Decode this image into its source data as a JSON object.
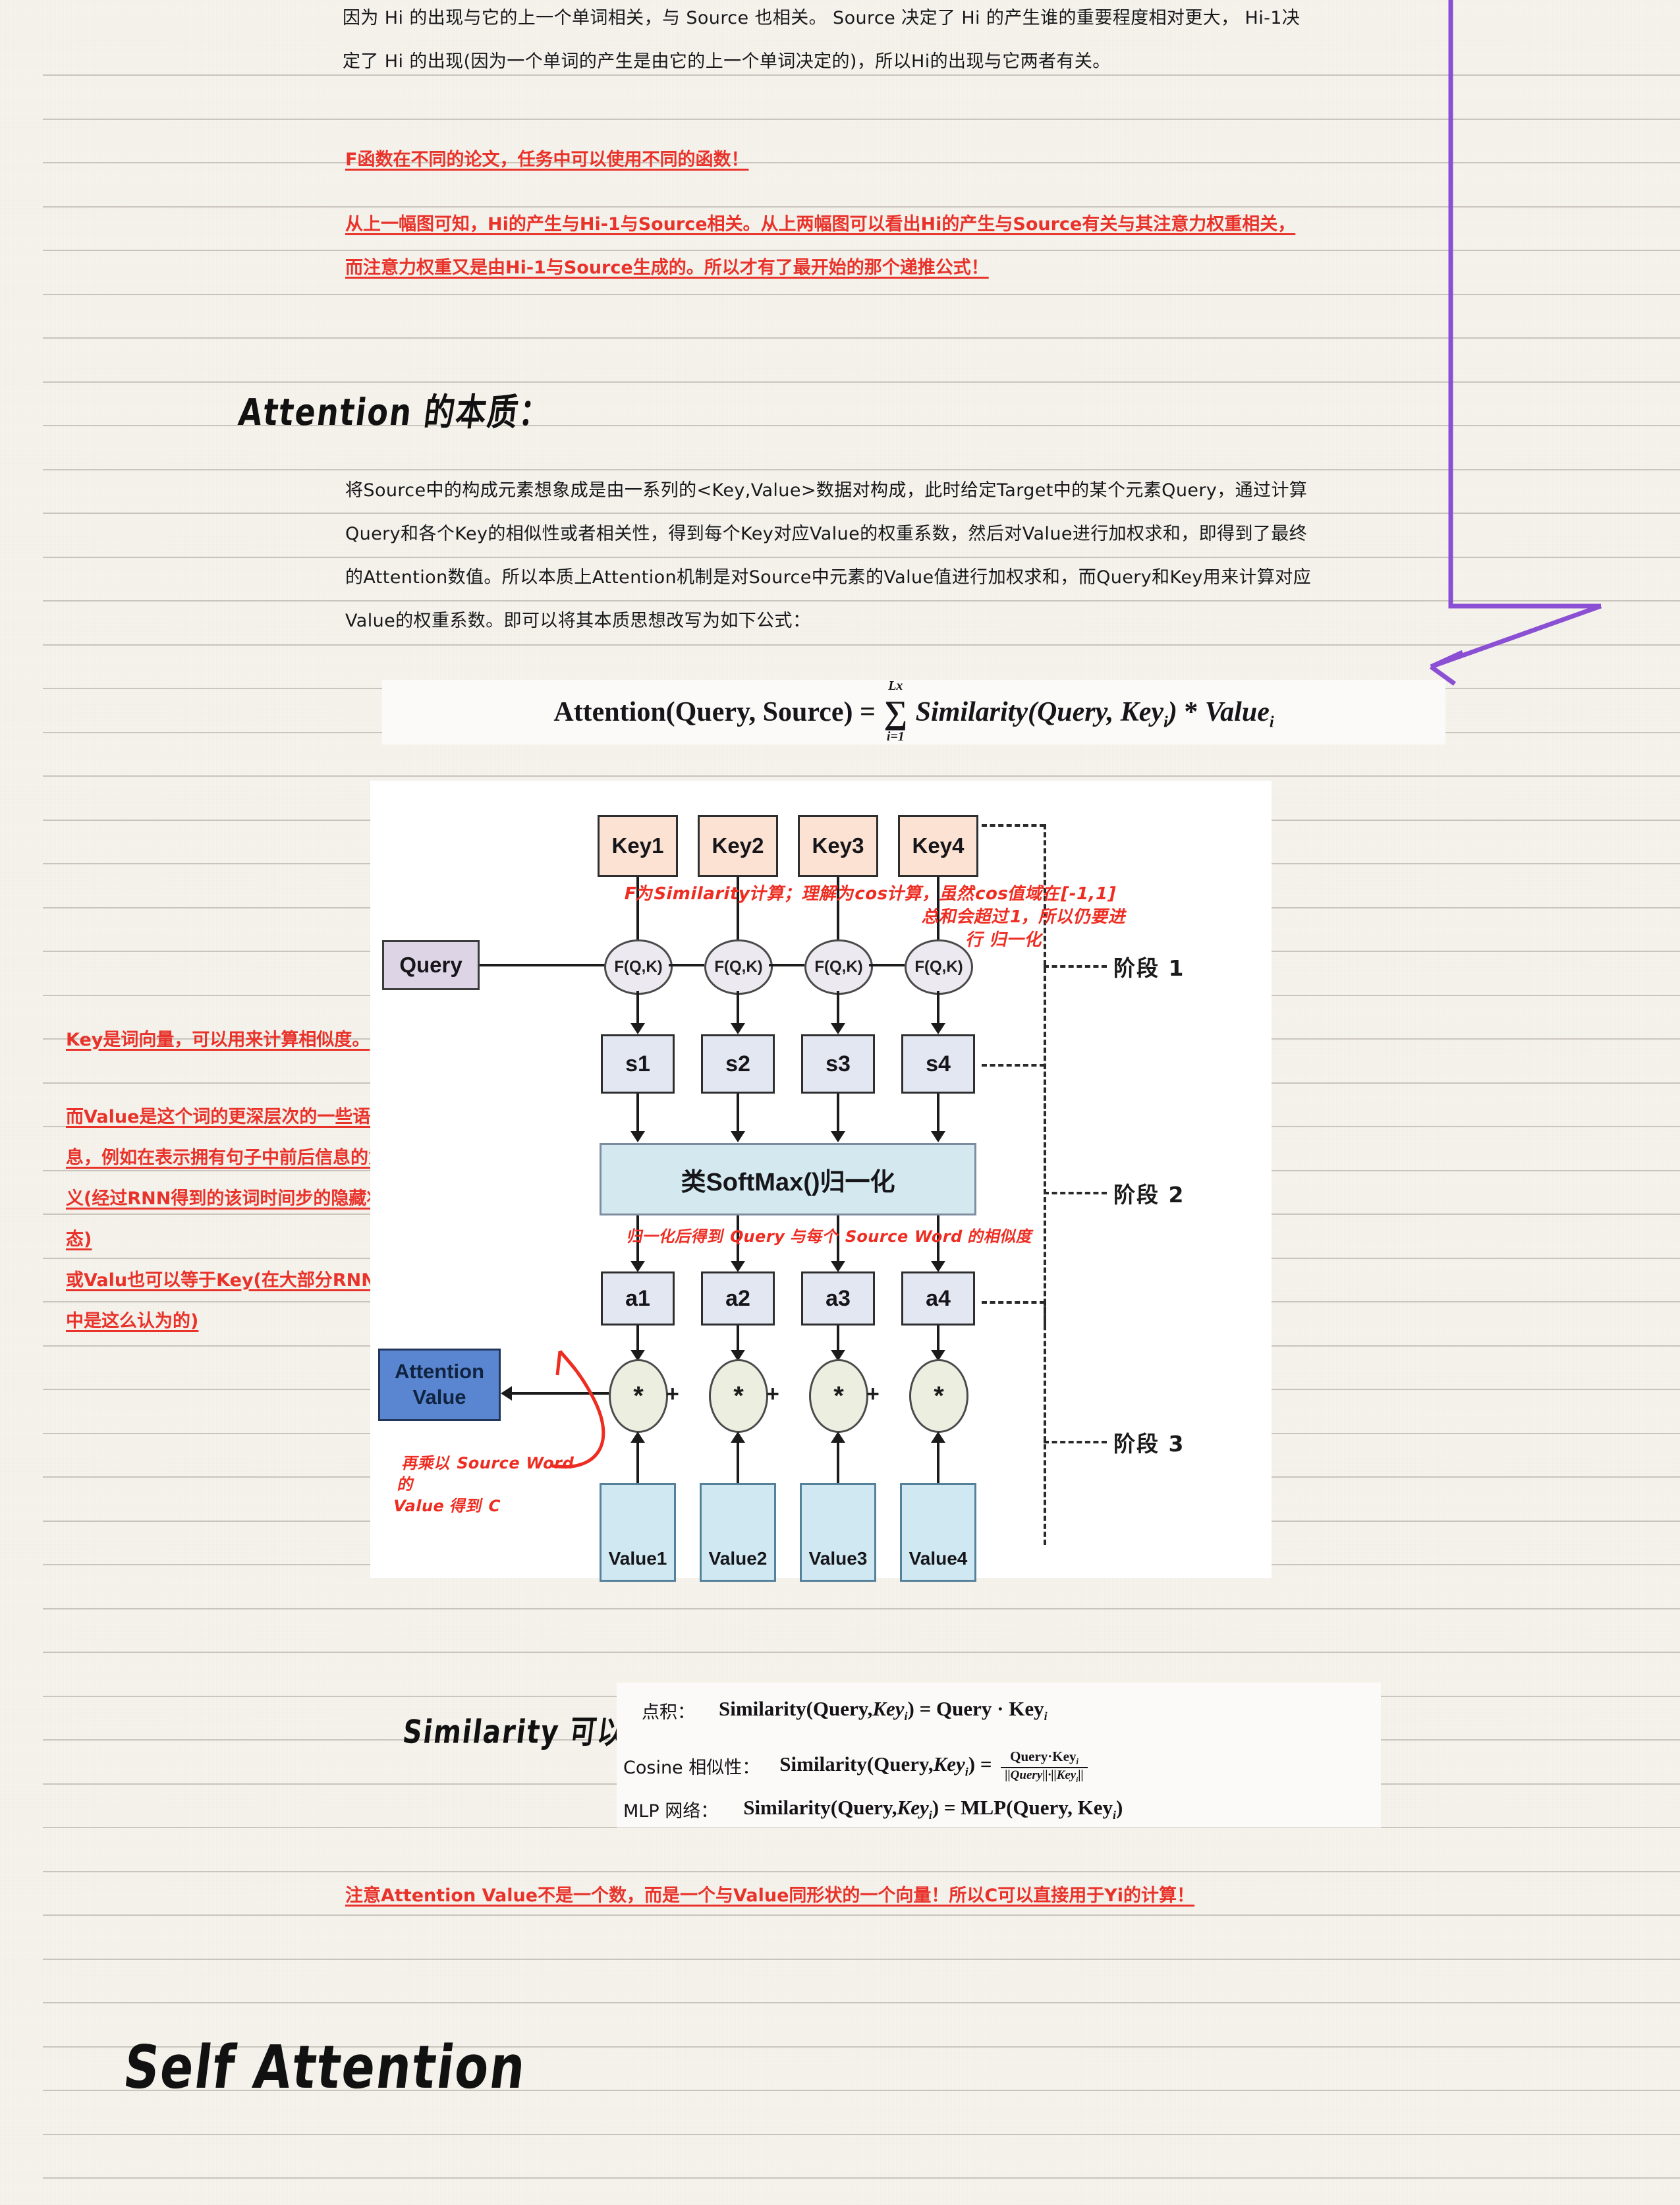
{
  "page": {
    "paper_color": "#f6f3ed",
    "rule_color": "#c9c5bd",
    "ink_red": "#e8322a",
    "ink_purple": "#8a4fd3"
  },
  "top_paragraph": {
    "line1": "因为 Hi 的出现与它的上一个单词相关，与 Source 也相关。 Source 决定了 Hi 的产生谁的重要程度相对更大， Hi-1决",
    "line2": "定了 Hi 的出现(因为一个单词的产生是由它的上一个单词决定的)，所以Hi的出现与它两者有关。"
  },
  "red_notes_top": {
    "note1": "F函数在不同的论文，任务中可以使用不同的函数！",
    "note2_line1": "从上一幅图可知，Hi的产生与Hi-1与Source相关。从上两幅图可以看出Hi的产生与Source有关与其注意力权重相关，",
    "note2_line2": "而注意力权重又是由Hi-1与Source生成的。所以才有了最开始的那个递推公式！"
  },
  "heading_attention_essence": "Attention 的本质：",
  "essence_paragraph": {
    "line1": "将Source中的构成元素想象成是由一系列的<Key,Value>数据对构成，此时给定Target中的某个元素Query，通过计算",
    "line2": "Query和各个Key的相似性或者相关性，得到每个Key对应Value的权重系数，然后对Value进行加权求和，即得到了最终",
    "line3": "的Attention数值。所以本质上Attention机制是对Source中元素的Value值进行加权求和，而Query和Key用来计算对应",
    "line4": "Value的权重系数。即可以将其本质思想改写为如下公式："
  },
  "main_formula": {
    "lhs": "Attention(Query, Source)",
    "eq": "=",
    "sum_symbol": "∑",
    "sum_upper": "Lx",
    "sum_lower": "i=1",
    "rhs_fn": "Similarity(Query, Key",
    "rhs_sub": "i",
    "rhs_close": ") ",
    "mult": "*",
    "rhs_value": "Value",
    "rhs_value_sub": "i",
    "full_text": "Attention(Query,Source) = ∑(i=1..Lx) Similarity(Query,Key_i) * Value_i"
  },
  "diagram": {
    "keys": [
      "Key1",
      "Key2",
      "Key3",
      "Key4"
    ],
    "query_label": "Query",
    "fqk_label": "F(Q,K)",
    "scores": [
      "s1",
      "s2",
      "s3",
      "s4"
    ],
    "softmax_label": "类SoftMax()归一化",
    "alphas": [
      "a1",
      "a2",
      "a3",
      "a4"
    ],
    "star_label": "*",
    "plus_label": "+",
    "values": [
      "Value1",
      "Value2",
      "Value3",
      "Value4"
    ],
    "attention_value_line1": "Attention",
    "attention_value_line2": "Value",
    "stages": [
      "阶段 1",
      "阶段 2",
      "阶段 3"
    ],
    "colors": {
      "key_fill": "#fbe2d2",
      "query_fill": "#ddd5e6",
      "score_fill": "#e3e7f2",
      "softmax_fill": "#d4e9ef",
      "value_fill": "#cfe8f2",
      "attention_value_fill": "#5a86d1",
      "fqk_fill": "#eceaf0",
      "star_fill": "#eceee0"
    },
    "handwritten": {
      "f_note_line1": "F为Similarity计算；理解为cos计算，虽然cos值域在[-1,1]",
      "f_note_line2": "总和会超过1，所以仍要进",
      "f_note_line3": "行 归一化",
      "softmax_note": "归一化后得到 Query 与每个 Source Word 的相似度",
      "value_note_line1": "再乘以 Source Word 的",
      "value_note_line2": "Value 得到 C"
    }
  },
  "red_notes_left": {
    "note1": "Key是词向量，可以用来计算相似度。",
    "note2_line1": "而Value是这个词的更深层次的一些语义信",
    "note2_line2": "息，例如在表示拥有句子中前后信息的意",
    "note2_line3": "义(经过RNN得到的该词时间步的隐藏状",
    "note2_line4": "态)",
    "note3_line1": "或Valu也可以等于Key(在大部分RNN任务",
    "note3_line2": "中是这么认为的)"
  },
  "heading_similarity": "Similarity 可以为：",
  "similarity_panel": {
    "rows": [
      {
        "label": "点积：",
        "formula": "Similarity(Query, Key_i) = Query · Key_i",
        "lhs": "Similarity(Query,",
        "key": "Key",
        "sub": "i",
        "rhs": ") = Query · Key",
        "rhs_sub": "i"
      },
      {
        "label": "Cosine 相似性：",
        "formula": "Similarity(Query, Key_i) = (Query·Key_i) / (||Query||·||Key_i||)",
        "numerator": "Query·Key",
        "numerator_sub": "i",
        "denominator": "||Query||·||Key",
        "denominator_sub": "i",
        "denominator_close": "||"
      },
      {
        "label": "MLP 网络：",
        "formula": "Similarity(Query, Key_i) = MLP(Query, Key_i)",
        "rhs": ") = MLP(Query, Key",
        "rhs_sub": "i"
      }
    ]
  },
  "red_note_bottom": "注意Attention Value不是一个数，而是一个与Value同形状的一个向量！所以C可以直接用于Yi的计算！",
  "heading_self_attention": "Self Attention"
}
